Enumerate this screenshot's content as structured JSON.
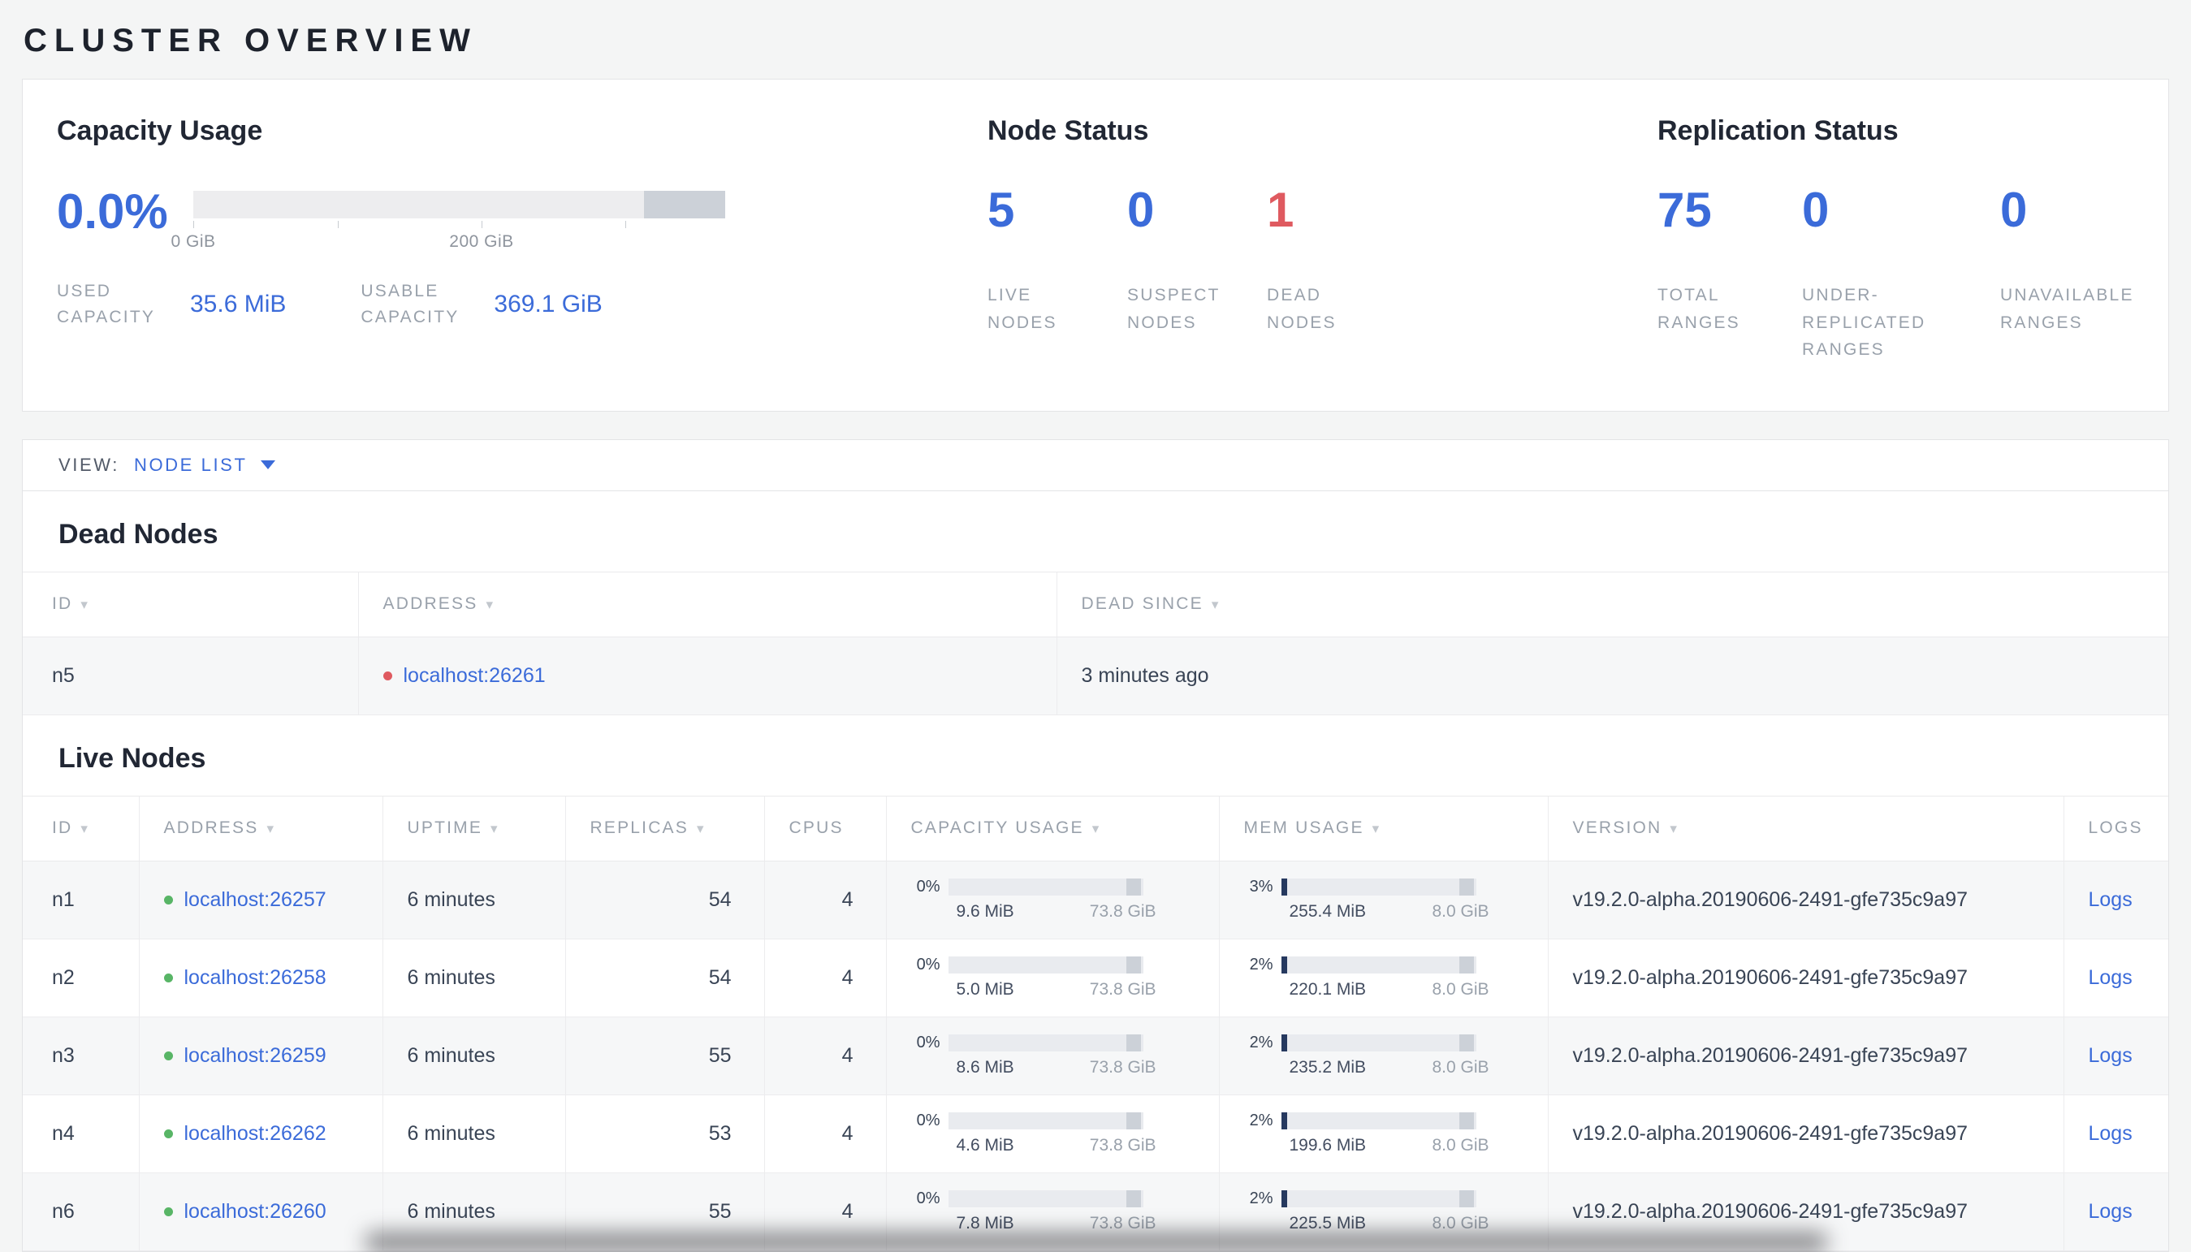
{
  "colors": {
    "accent": "#3b6bd9",
    "danger": "#df5a60",
    "ok": "#58b566",
    "text_dark": "#394455",
    "label_gray": "#99a1ab",
    "border": "#e3e4e6",
    "row_alt": "#f6f7f8",
    "bar_track": "#ededef",
    "bar_marker": "#ccd1d8",
    "bar_fill": "#26395f"
  },
  "page_title": "CLUSTER OVERVIEW",
  "summary": {
    "capacity": {
      "heading": "Capacity Usage",
      "percent": "0.0%",
      "tick_labels": [
        "0 GiB",
        "200 GiB"
      ],
      "used_label": "USED CAPACITY",
      "used_value": "35.6 MiB",
      "usable_label": "USABLE CAPACITY",
      "usable_value": "369.1 GiB"
    },
    "node_status": {
      "heading": "Node Status",
      "stats": [
        {
          "value": "5",
          "label": "LIVE NODES"
        },
        {
          "value": "0",
          "label": "SUSPECT NODES"
        },
        {
          "value": "1",
          "label": "DEAD NODES"
        }
      ]
    },
    "replication": {
      "heading": "Replication Status",
      "stats": [
        {
          "value": "75",
          "label": "TOTAL RANGES"
        },
        {
          "value": "0",
          "label": "UNDER-REPLICATED RANGES"
        },
        {
          "value": "0",
          "label": "UNAVAILABLE RANGES"
        }
      ]
    }
  },
  "view_bar": {
    "label": "VIEW:",
    "selected": "NODE LIST"
  },
  "dead_nodes": {
    "heading": "Dead Nodes",
    "columns": [
      {
        "label": "ID",
        "sortable": true
      },
      {
        "label": "ADDRESS",
        "sortable": true
      },
      {
        "label": "DEAD SINCE",
        "sortable": true
      }
    ],
    "rows": [
      {
        "id": "n5",
        "address": "localhost:26261",
        "dead_since": "3 minutes ago"
      }
    ]
  },
  "live_nodes": {
    "heading": "Live Nodes",
    "columns": [
      {
        "label": "ID",
        "sortable": true
      },
      {
        "label": "ADDRESS",
        "sortable": true
      },
      {
        "label": "UPTIME",
        "sortable": true
      },
      {
        "label": "REPLICAS",
        "sortable": true
      },
      {
        "label": "CPUS",
        "sortable": false
      },
      {
        "label": "CAPACITY USAGE",
        "sortable": true
      },
      {
        "label": "MEM USAGE",
        "sortable": true
      },
      {
        "label": "VERSION",
        "sortable": true
      },
      {
        "label": "LOGS",
        "sortable": false
      }
    ],
    "rows": [
      {
        "id": "n1",
        "address": "localhost:26257",
        "uptime": "6 minutes",
        "replicas": "54",
        "cpus": "4",
        "capacity": {
          "pct": "0%",
          "pct_num": 0,
          "used": "9.6 MiB",
          "total": "73.8 GiB"
        },
        "memory": {
          "pct": "3%",
          "pct_num": 3,
          "used": "255.4 MiB",
          "total": "8.0 GiB"
        },
        "version": "v19.2.0-alpha.20190606-2491-gfe735c9a97",
        "logs_label": "Logs"
      },
      {
        "id": "n2",
        "address": "localhost:26258",
        "uptime": "6 minutes",
        "replicas": "54",
        "cpus": "4",
        "capacity": {
          "pct": "0%",
          "pct_num": 0,
          "used": "5.0 MiB",
          "total": "73.8 GiB"
        },
        "memory": {
          "pct": "2%",
          "pct_num": 2,
          "used": "220.1 MiB",
          "total": "8.0 GiB"
        },
        "version": "v19.2.0-alpha.20190606-2491-gfe735c9a97",
        "logs_label": "Logs"
      },
      {
        "id": "n3",
        "address": "localhost:26259",
        "uptime": "6 minutes",
        "replicas": "55",
        "cpus": "4",
        "capacity": {
          "pct": "0%",
          "pct_num": 0,
          "used": "8.6 MiB",
          "total": "73.8 GiB"
        },
        "memory": {
          "pct": "2%",
          "pct_num": 2,
          "used": "235.2 MiB",
          "total": "8.0 GiB"
        },
        "version": "v19.2.0-alpha.20190606-2491-gfe735c9a97",
        "logs_label": "Logs"
      },
      {
        "id": "n4",
        "address": "localhost:26262",
        "uptime": "6 minutes",
        "replicas": "53",
        "cpus": "4",
        "capacity": {
          "pct": "0%",
          "pct_num": 0,
          "used": "4.6 MiB",
          "total": "73.8 GiB"
        },
        "memory": {
          "pct": "2%",
          "pct_num": 2,
          "used": "199.6 MiB",
          "total": "8.0 GiB"
        },
        "version": "v19.2.0-alpha.20190606-2491-gfe735c9a97",
        "logs_label": "Logs"
      },
      {
        "id": "n6",
        "address": "localhost:26260",
        "uptime": "6 minutes",
        "replicas": "55",
        "cpus": "4",
        "capacity": {
          "pct": "0%",
          "pct_num": 0,
          "used": "7.8 MiB",
          "total": "73.8 GiB"
        },
        "memory": {
          "pct": "2%",
          "pct_num": 2,
          "used": "225.5 MiB",
          "total": "8.0 GiB"
        },
        "version": "v19.2.0-alpha.20190606-2491-gfe735c9a97",
        "logs_label": "Logs"
      }
    ]
  }
}
